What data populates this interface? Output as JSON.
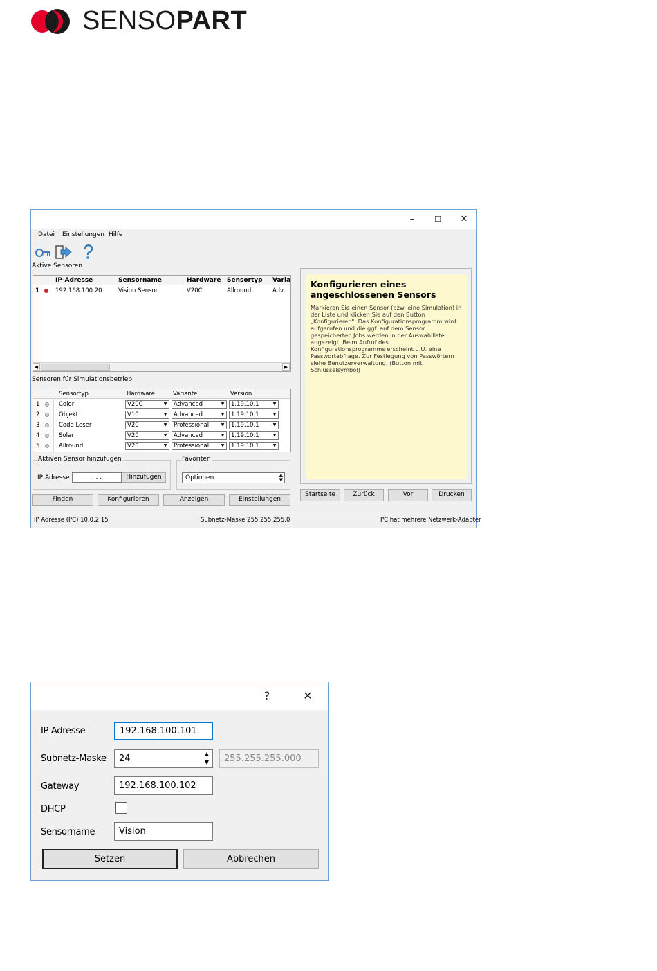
{
  "logo": {
    "text_light": "SENSO",
    "text_bold": "PART",
    "mark_colors": [
      "#e4002b",
      "#1a1a1a"
    ]
  },
  "main_window": {
    "controls": {
      "minimize": "–",
      "maximize": "☐",
      "close": "✕"
    },
    "menu": [
      "Datei",
      "Einstellungen",
      "Hilfe"
    ],
    "toolbar_icons": [
      "key-icon",
      "exit-icon",
      "help-icon"
    ],
    "active_sensors": {
      "label": "Aktive Sensoren",
      "columns": [
        "IP-Adresse",
        "Sensorname",
        "Hardware",
        "Sensortyp",
        "Varian"
      ],
      "rows": [
        {
          "num": "1",
          "ip": "192.168.100.20",
          "name": "Vision Sensor",
          "hardware": "V20C",
          "type": "Allround",
          "variant": "Adv..."
        }
      ]
    },
    "simulation": {
      "label": "Sensoren für Simulationsbetrieb",
      "columns": [
        "Sensortyp",
        "Hardware",
        "Variante",
        "Version"
      ],
      "rows": [
        {
          "num": "1",
          "type": "Color",
          "hardware": "V20C",
          "variant": "Advanced",
          "version": "1.19.10.1"
        },
        {
          "num": "2",
          "type": "Objekt",
          "hardware": "V10",
          "variant": "Advanced",
          "version": "1.19.10.1"
        },
        {
          "num": "3",
          "type": "Code Leser",
          "hardware": "V20",
          "variant": "Professional",
          "version": "1.19.10.1"
        },
        {
          "num": "4",
          "type": "Solar",
          "hardware": "V20",
          "variant": "Advanced",
          "version": "1.19.10.1"
        },
        {
          "num": "5",
          "type": "Allround",
          "hardware": "V20",
          "variant": "Professional",
          "version": "1.19.10.1"
        }
      ]
    },
    "add_sensor": {
      "title": "Aktiven Sensor hinzufügen",
      "ip_label": "IP Adresse",
      "ip_value": ". . .",
      "add_button": "Hinzufügen"
    },
    "favorites": {
      "title": "Favoriten",
      "selected": "Optionen"
    },
    "buttons": {
      "find": "Finden",
      "configure": "Konfigurieren",
      "show": "Anzeigen",
      "settings": "Einstellungen"
    },
    "help": {
      "title": "Konfigurieren eines angeschlossenen Sensors",
      "text": "Markieren Sie einen Sensor (bzw. eine Simulation) in der Liste und klicken Sie auf den Button „Konfigurieren\". Das Konfigurationsprogramm wird aufgerufen und die ggf. auf dem Sensor gespeicherten Jobs werden in der Auswahlliste angezeigt. Beim Aufruf des Konfigurationsprogramms erscheint u.U. eine Passwortabfrage. Zur Festlegung von Passwörtern siehe Benutzerverwaltung. (Button mit Schlüsselsymbol)",
      "buttons": {
        "home": "Startseite",
        "back": "Zurück",
        "forward": "Vor",
        "print": "Drucken"
      }
    },
    "status": {
      "ip": "IP Adresse (PC)  10.0.2.15",
      "subnet": "Subnetz-Maske   255.255.255.0",
      "note": "PC hat mehrere Netzwerk-Adapter"
    }
  },
  "dialog": {
    "controls": {
      "help": "?",
      "close": "✕"
    },
    "ip_label": "IP Adresse",
    "ip_value": "192.168.100.101",
    "subnet_label": "Subnetz-Maske",
    "subnet_value": "24",
    "subnet_full": "255.255.255.000",
    "gateway_label": "Gateway",
    "gateway_value": "192.168.100.102",
    "dhcp_label": "DHCP",
    "dhcp_checked": false,
    "name_label": "Sensorname",
    "name_value": "Vision",
    "set_button": "Setzen",
    "cancel_button": "Abbrechen"
  }
}
